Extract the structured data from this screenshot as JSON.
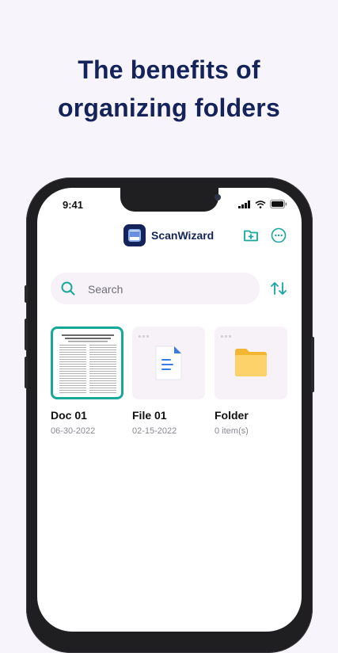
{
  "headline": {
    "line1": "The benefits of",
    "line2": "organizing folders"
  },
  "status_bar": {
    "time": "9:41"
  },
  "header": {
    "app_name": "ScanWizard"
  },
  "search": {
    "placeholder": "Search"
  },
  "items": [
    {
      "name": "Doc 01",
      "meta": "06-30-2022",
      "type": "document",
      "selected": true
    },
    {
      "name": "File 01",
      "meta": "02-15-2022",
      "type": "file",
      "selected": false
    },
    {
      "name": "Folder",
      "meta": "0 item(s)",
      "type": "folder",
      "selected": false
    }
  ],
  "colors": {
    "brand": "#14245a",
    "accent": "#18a89a",
    "background": "#f8f4fb"
  }
}
